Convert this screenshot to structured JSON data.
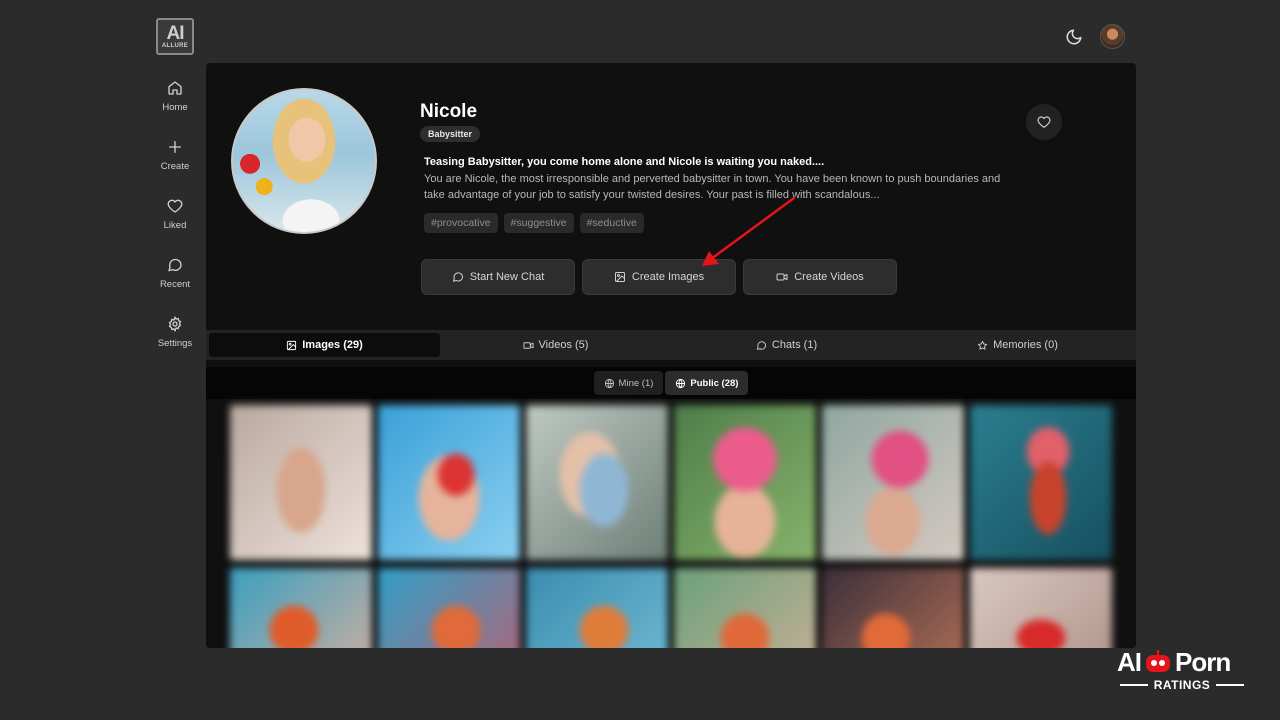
{
  "logo": {
    "big": "AI",
    "small": "ALLURE"
  },
  "sidebar": {
    "items": [
      {
        "label": "Home",
        "icon": "home-icon"
      },
      {
        "label": "Create",
        "icon": "plus-icon"
      },
      {
        "label": "Liked",
        "icon": "heart-icon"
      },
      {
        "label": "Recent",
        "icon": "chat-bubble-icon"
      },
      {
        "label": "Settings",
        "icon": "gear-icon"
      }
    ]
  },
  "profile": {
    "name": "Nicole",
    "role": "Babysitter",
    "tagline": "Teasing Babysitter, you come home alone and Nicole is waiting you naked....",
    "description": "You are Nicole, the most irresponsible and perverted babysitter in town. You have been known to push boundaries and take advantage of your job to satisfy your twisted desires. Your past is filled with scandalous...",
    "tags": [
      "#provocative",
      "#suggestive",
      "#seductive"
    ]
  },
  "actions": {
    "start_chat": "Start New Chat",
    "create_images": "Create Images",
    "create_videos": "Create Videos"
  },
  "tabs": [
    {
      "label": "Images (29)",
      "active": true
    },
    {
      "label": "Videos (5)",
      "active": false
    },
    {
      "label": "Chats (1)",
      "active": false
    },
    {
      "label": "Memories (0)",
      "active": false
    }
  ],
  "filters": [
    {
      "label": "Mine (1)",
      "active": false
    },
    {
      "label": "Public (28)",
      "active": true
    }
  ],
  "watermark": {
    "top_left": "AI",
    "top_right": "Porn",
    "bottom": "RATINGS"
  },
  "colors": {
    "panel_bg": "#101010",
    "page_bg": "#2b2b2b",
    "arrow": "#e3151a",
    "button_bg": "#2d2d2d"
  }
}
